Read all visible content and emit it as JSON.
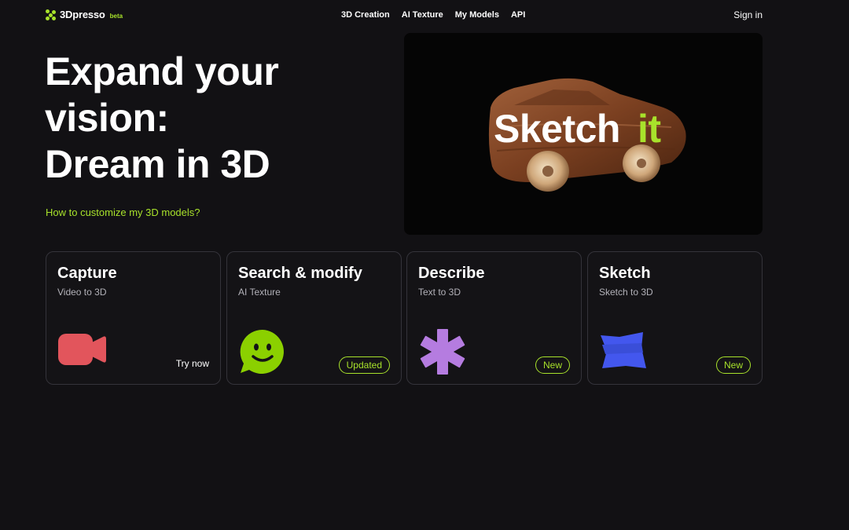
{
  "nav": {
    "logo": {
      "name": "3Dpresso",
      "tag": "beta"
    },
    "links": [
      "3D Creation",
      "AI Texture",
      "My Models",
      "API"
    ],
    "signin": "Sign in"
  },
  "hero": {
    "title_lines": [
      "Expand your",
      "vision:",
      "Dream in 3D"
    ],
    "link": "How to customize my 3D models?",
    "media": {
      "caption_word_1": "Sketch",
      "caption_word_2": "it",
      "image": "wooden-toy-car"
    }
  },
  "cards": [
    {
      "title": "Capture",
      "subtitle": "Video to 3D",
      "icon": "video-camera-icon",
      "icon_color": "#e2555c",
      "cta": "Try now"
    },
    {
      "title": "Search & modify",
      "subtitle": "AI Texture",
      "icon": "smiley-chat-icon",
      "icon_color": "#8bd000",
      "badge": "Updated"
    },
    {
      "title": "Describe",
      "subtitle": "Text to 3D",
      "icon": "asterisk-icon",
      "icon_color": "#b57ce0",
      "badge": "New"
    },
    {
      "title": "Sketch",
      "subtitle": "Sketch to 3D",
      "icon": "sketch-shape-icon",
      "icon_color": "#4357ee",
      "badge": "New"
    }
  ],
  "colors": {
    "background": "#121114",
    "accent": "#a8e22b",
    "card_border": "#34333a"
  }
}
